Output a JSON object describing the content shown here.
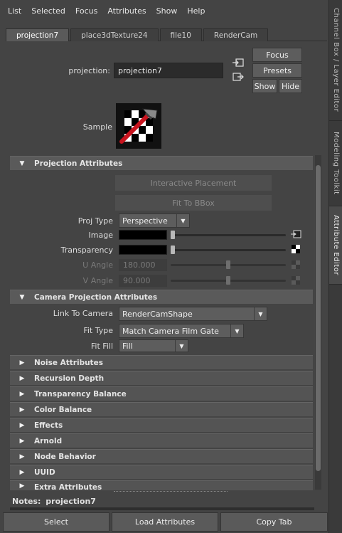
{
  "menu": [
    "List",
    "Selected",
    "Focus",
    "Attributes",
    "Show",
    "Help"
  ],
  "side_tabs": [
    "Channel Box / Layer Editor",
    "Modeling Toolkit",
    "Attribute Editor"
  ],
  "tabs": [
    "projection7",
    "place3dTexture24",
    "file10",
    "RenderCam"
  ],
  "header": {
    "node_label": "projection:",
    "node_value": "projection7",
    "focus": "Focus",
    "presets": "Presets",
    "show": "Show",
    "hide": "Hide",
    "sample_label": "Sample"
  },
  "projection": {
    "title": "Projection Attributes",
    "interactive_placement": "Interactive Placement",
    "fit_to_bbox": "Fit To BBox",
    "proj_type_label": "Proj Type",
    "proj_type_value": "Perspective",
    "image_label": "Image",
    "transparency_label": "Transparency",
    "u_angle_label": "U Angle",
    "u_angle_value": "180.000",
    "v_angle_label": "V Angle",
    "v_angle_value": "90.000"
  },
  "camera": {
    "title": "Camera Projection Attributes",
    "link_label": "Link To Camera",
    "link_value": "RenderCamShape",
    "fit_type_label": "Fit Type",
    "fit_type_value": "Match Camera Film Gate",
    "fit_fill_label": "Fit Fill",
    "fit_fill_value": "Fill"
  },
  "collapsed_sections": [
    "Noise Attributes",
    "Recursion Depth",
    "Transparency Balance",
    "Color Balance",
    "Effects",
    "Arnold",
    "Node Behavior",
    "UUID",
    "Extra Attributes"
  ],
  "notes": {
    "label": "Notes:",
    "value": "projection7"
  },
  "bottom": {
    "select": "Select",
    "load": "Load Attributes",
    "copy": "Copy Tab"
  },
  "colors": {
    "panel": "#444444",
    "section": "#5a5a5a",
    "field": "#2b2b2b",
    "swatch": "#000000"
  }
}
